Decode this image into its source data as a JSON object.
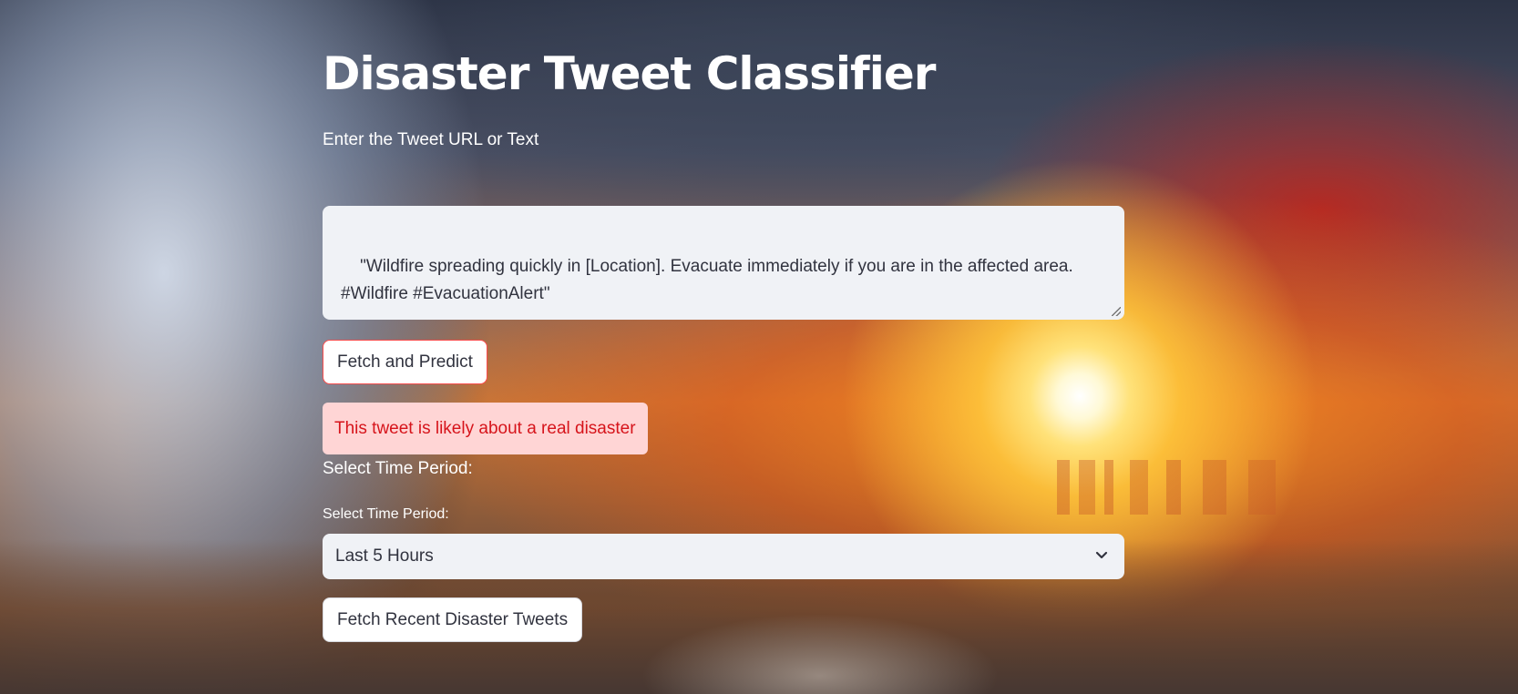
{
  "app": {
    "title": "Disaster Tweet Classifier",
    "subtitle": "Enter the Tweet URL or Text"
  },
  "tweet_input": {
    "value": "\"Wildfire spreading quickly in [Location]. Evacuate immediately if you are in the affected area.\n#Wildfire #EvacuationAlert\""
  },
  "predict_button": {
    "label": "Fetch and Predict"
  },
  "result": {
    "message": "This tweet is likely about a real disaster",
    "status_color": "#d6141b",
    "background_color": "#ffd5d5"
  },
  "time_section": {
    "heading": "Select Time Period:",
    "field_label": "Select Time Period:",
    "selected_option": "Last 5 Hours",
    "chevron_icon": "chevron-down-icon"
  },
  "fetch_button": {
    "label": "Fetch Recent Disaster Tweets"
  },
  "colors": {
    "accent": "#ff4b4b",
    "input_background": "#f0f2f6",
    "text": "#31333f"
  }
}
